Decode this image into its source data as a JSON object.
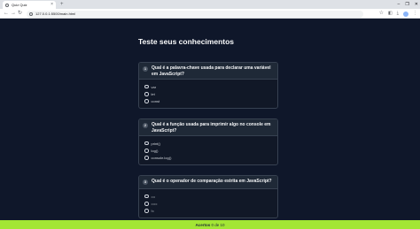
{
  "browser": {
    "tab_title": "Quiz Quiz",
    "url": "127.0.0.1:5500/main.html",
    "new_tab_symbol": "+",
    "tab_close_symbol": "×",
    "window_controls": [
      "–",
      "❐",
      "✕"
    ]
  },
  "page": {
    "title": "Teste seus conhecimentos"
  },
  "questions": [
    {
      "number": "1",
      "text": "Qual é a palavra-chave usada para declarar uma variável em JavaScript?",
      "options": [
        "var",
        "let",
        "const"
      ]
    },
    {
      "number": "2",
      "text": "Qual é a função usada para imprimir algo no console em JavaScript?",
      "options": [
        "print()",
        "log()",
        "console.log()"
      ]
    },
    {
      "number": "3",
      "text": "Qual é o operador de comparação estrita em JavaScript?",
      "options": [
        "==",
        "===",
        "!="
      ]
    }
  ],
  "status": {
    "label": "Acertos",
    "score": "0",
    "separator": "de",
    "total": "10"
  },
  "colors": {
    "background": "#0f172a",
    "card": "#111827",
    "card_header": "#1f2937",
    "status_bar": "#a3e635"
  }
}
